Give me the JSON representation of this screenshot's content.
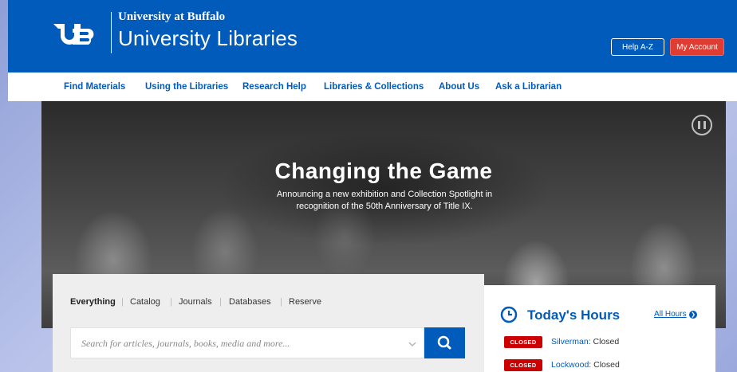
{
  "header": {
    "university": "University at Buffalo",
    "library": "University Libraries",
    "help_label": "Help A-Z",
    "account_label": "My Account",
    "brand_color": "#005bbb",
    "account_color": "#e03c31"
  },
  "nav": {
    "items": [
      {
        "label": "Find Materials"
      },
      {
        "label": "Using the Libraries"
      },
      {
        "label": "Research Help"
      },
      {
        "label": "Libraries & Collections"
      },
      {
        "label": "About Us"
      },
      {
        "label": "Ask a Librarian"
      }
    ]
  },
  "hero": {
    "title": "Changing the Game",
    "subtitle": "Announcing a new exhibition and Collection Spotlight in recognition of the 50th Anniversary of Title IX.",
    "pause_icon": "pause-icon"
  },
  "search": {
    "tabs": [
      {
        "label": "Everything",
        "active": true
      },
      {
        "label": "Catalog"
      },
      {
        "label": "Journals"
      },
      {
        "label": "Databases"
      },
      {
        "label": "Reserve"
      }
    ],
    "separator": "|",
    "placeholder": "Search for articles, journals, books, media and more...",
    "search_icon": "search-icon"
  },
  "hours": {
    "title": "Today's Hours",
    "all_hours_label": "All Hours",
    "libraries": [
      {
        "status": "CLOSED",
        "name": "Silverman",
        "state": ": Closed"
      },
      {
        "status": "CLOSED",
        "name": "Lockwood",
        "state": ": Closed"
      }
    ],
    "closed_color": "#cc0000"
  }
}
